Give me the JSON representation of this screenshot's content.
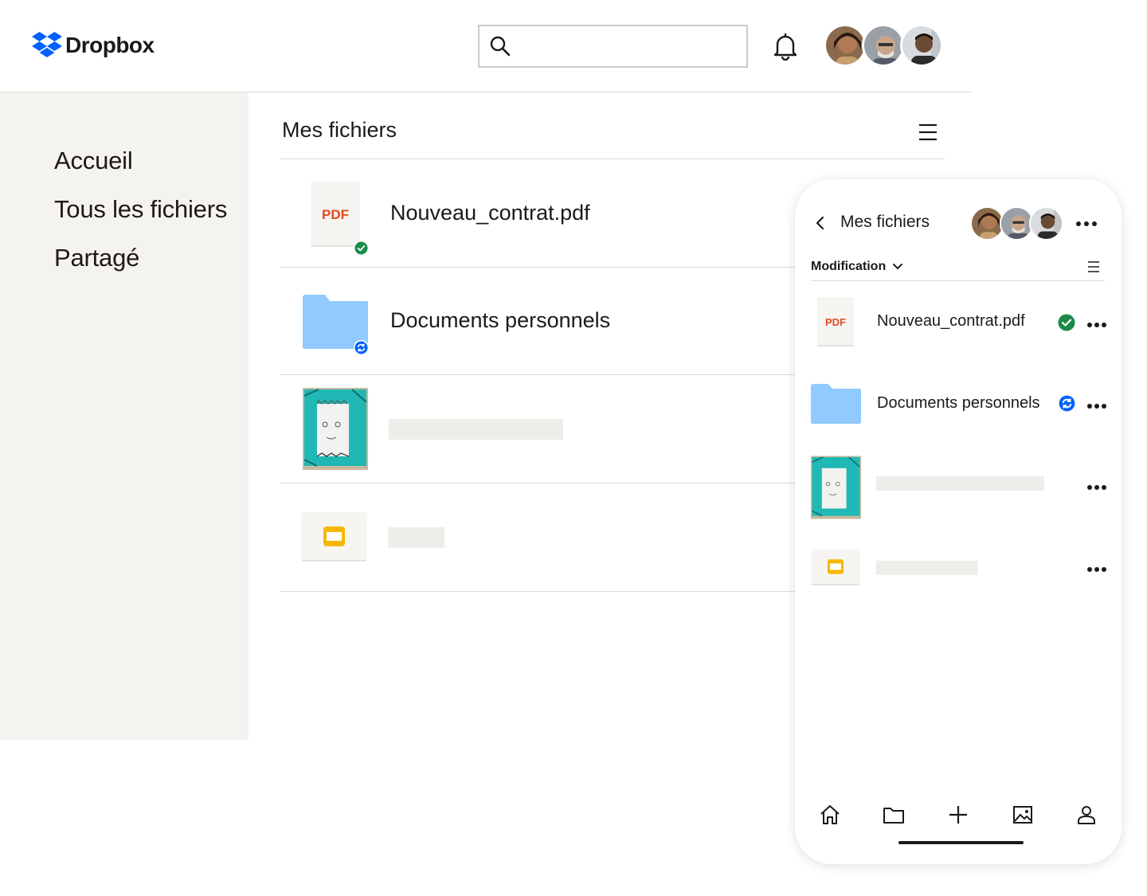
{
  "app": {
    "name": "Dropbox",
    "brand_color": "#0061fe"
  },
  "search": {
    "value": "",
    "placeholder": ""
  },
  "sidebar": {
    "items": [
      {
        "label": "Accueil"
      },
      {
        "label": "Tous les fichiers"
      },
      {
        "label": "Partagé"
      }
    ]
  },
  "main": {
    "title": "Mes fichiers",
    "files": [
      {
        "name": "Nouveau_contrat.pdf",
        "type": "pdf",
        "type_label": "PDF",
        "status": "synced"
      },
      {
        "name": "Documents personnels",
        "type": "folder",
        "status": "syncing"
      },
      {
        "name": "",
        "type": "image"
      },
      {
        "name": "",
        "type": "slides"
      }
    ]
  },
  "mobile": {
    "title": "Mes fichiers",
    "sort_label": "Modification",
    "files": [
      {
        "name": "Nouveau_contrat.pdf",
        "type_label": "PDF",
        "status": "synced"
      },
      {
        "name": "Documents personnels",
        "status": "syncing"
      },
      {
        "name": ""
      },
      {
        "name": ""
      }
    ],
    "nav": [
      "home-icon",
      "folder-icon",
      "plus-icon",
      "photos-icon",
      "account-icon"
    ]
  },
  "colors": {
    "sidebar_bg": "#f5f3ef",
    "folder": "#90caff",
    "pdf_label": "#e14a1d",
    "synced_badge": "#1a8a48",
    "syncing_badge": "#0061fe",
    "slides_icon": "#f5b800",
    "image_bg": "#1fb8b5"
  }
}
